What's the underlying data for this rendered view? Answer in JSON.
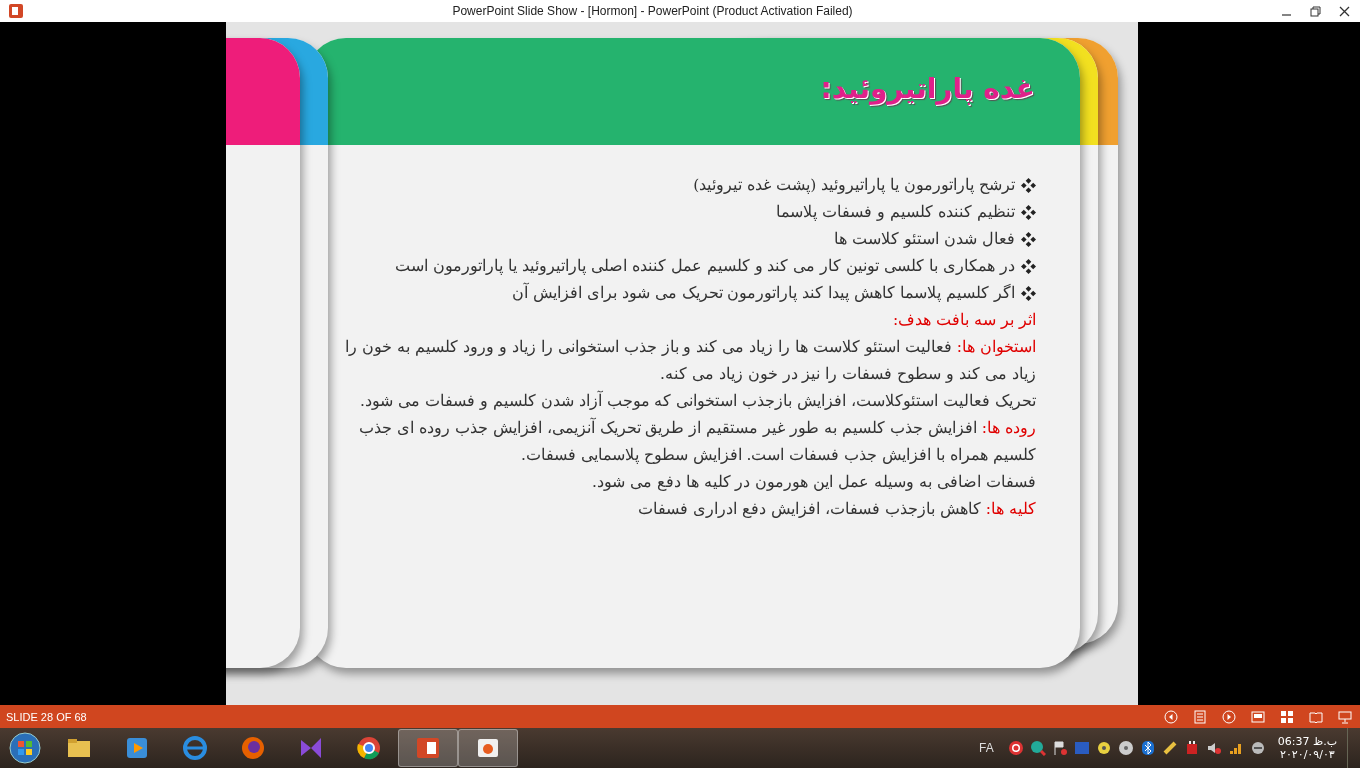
{
  "window": {
    "title": "PowerPoint Slide Show - [Hormon] - PowerPoint (Product Activation Failed)"
  },
  "slide": {
    "title": "غده پاراتیروئید:",
    "bullets": [
      "ترشح پاراتورمون یا پاراتیروئید (پشت غده تیروئید)",
      "تنظیم کننده کلسیم و فسفات پلاسما",
      "فعال شدن استئو کلاست ها",
      "در همکاری با کلسی تونین کار می کند و کلسیم عمل کننده اصلی پاراتیروئید یا پاراتورمون است",
      "اگر کلسیم پلاسما کاهش پیدا کند پاراتورمون تحریک می شود برای افزایش آن"
    ],
    "subheading": "اثر بر سه بافت هدف:",
    "paragraphs": [
      {
        "kind": "labeled",
        "label": "استخوان ها:",
        "text": "فعالیت استئو کلاست ها را زیاد می کند و باز جذب استخوانی را زیاد و ورود کلسیم به خون را زیاد می کند و سطوح فسفات را نیز در خون زیاد می کنه."
      },
      {
        "kind": "plain",
        "text": "تحریک فعالیت استئوکلاست، افزایش بازجذب استخوانی که موجب آزاد شدن کلسیم و فسفات می شود."
      },
      {
        "kind": "labeled",
        "label": "روده ها:",
        "text": "افزایش جذب کلسیم به طور غیر مستقیم از طریق تحریک آنزیمی، افزایش جذب روده ای جذب کلسیم همراه با افزایش جذب فسفات است. افزایش سطوح پلاسمایی فسفات."
      },
      {
        "kind": "plain",
        "text": "فسفات اضافی به وسیله عمل این هورمون در کلیه ها دفع می شود."
      },
      {
        "kind": "labeled",
        "label": "کلیه ها:",
        "text": "کاهش بازجذب فسفات، افزایش دفع ادراری فسفات"
      }
    ]
  },
  "status_bar": {
    "slide_counter": "SLIDE 28 OF 68"
  },
  "taskbar": {
    "language": "FA",
    "time": "06:37 ب.ظ",
    "date": "۲۰۲۰/۰۹/۰۳"
  }
}
